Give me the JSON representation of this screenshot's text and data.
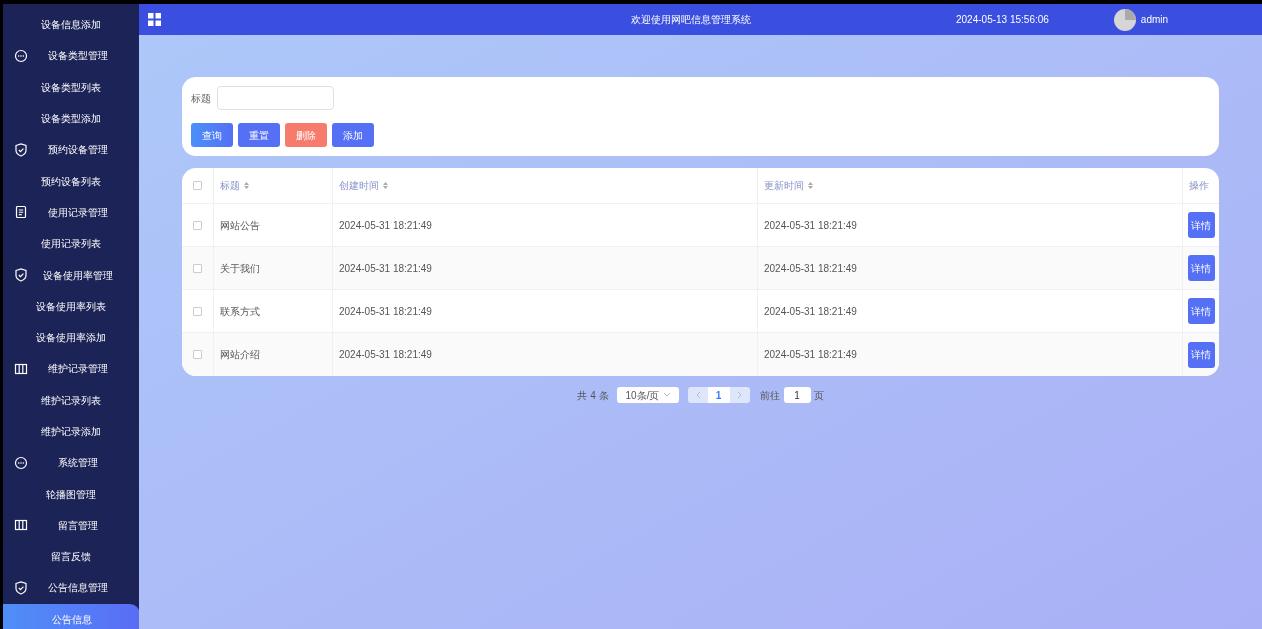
{
  "sidebar": {
    "items": [
      {
        "kind": "item",
        "label": "设备信息添加",
        "selected": false
      },
      {
        "kind": "chat",
        "label": "设备类型管理"
      },
      {
        "kind": "item",
        "label": "设备类型列表",
        "selected": false
      },
      {
        "kind": "item",
        "label": "设备类型添加",
        "selected": false
      },
      {
        "kind": "shield",
        "label": "预约设备管理"
      },
      {
        "kind": "item",
        "label": "预约设备列表",
        "selected": false
      },
      {
        "kind": "document",
        "label": "使用记录管理"
      },
      {
        "kind": "item",
        "label": "使用记录列表",
        "selected": false
      },
      {
        "kind": "shield",
        "label": "设备使用率管理"
      },
      {
        "kind": "item",
        "label": "设备使用率列表",
        "selected": false
      },
      {
        "kind": "item",
        "label": "设备使用率添加",
        "selected": false
      },
      {
        "kind": "columns",
        "label": "维护记录管理"
      },
      {
        "kind": "item",
        "label": "维护记录列表",
        "selected": false
      },
      {
        "kind": "item",
        "label": "维护记录添加",
        "selected": false
      },
      {
        "kind": "chat",
        "label": "系统管理"
      },
      {
        "kind": "item",
        "label": "轮播图管理",
        "selected": false
      },
      {
        "kind": "columns",
        "label": "留言管理"
      },
      {
        "kind": "item",
        "label": "留言反馈",
        "selected": false
      },
      {
        "kind": "shield",
        "label": "公告信息管理"
      },
      {
        "kind": "item",
        "label": "公告信息",
        "selected": true
      }
    ]
  },
  "header": {
    "title": "欢迎使用网吧信息管理系统",
    "datetime": "2024-05-13 15:56:06",
    "user": "admin"
  },
  "search": {
    "label": "标题",
    "buttons": [
      {
        "kind": "query",
        "label": "查询"
      },
      {
        "kind": "reset",
        "label": "重置"
      },
      {
        "kind": "delete",
        "label": "删除"
      },
      {
        "kind": "add",
        "label": "添加"
      }
    ]
  },
  "table": {
    "all_checked": false,
    "columns": [
      "标题",
      "创建时间",
      "更新时间",
      "操作"
    ],
    "rows": [
      {
        "checked": false,
        "title": "网站公告",
        "created": "2024-05-31 18:21:49",
        "updated": "2024-05-31 18:21:49",
        "action": "详情"
      },
      {
        "checked": false,
        "title": "关于我们",
        "created": "2024-05-31 18:21:49",
        "updated": "2024-05-31 18:21:49",
        "action": "详情"
      },
      {
        "checked": false,
        "title": "联系方式",
        "created": "2024-05-31 18:21:49",
        "updated": "2024-05-31 18:21:49",
        "action": "详情"
      },
      {
        "checked": false,
        "title": "网站介绍",
        "created": "2024-05-31 18:21:49",
        "updated": "2024-05-31 18:21:49",
        "action": "详情"
      }
    ]
  },
  "pagination": {
    "total": "共 4 条",
    "page_size": "10条/页",
    "pages": [
      {
        "label": "1",
        "selected": true
      }
    ],
    "goto_label": "前往",
    "goto_value": "1",
    "goto_suffix": "页"
  }
}
